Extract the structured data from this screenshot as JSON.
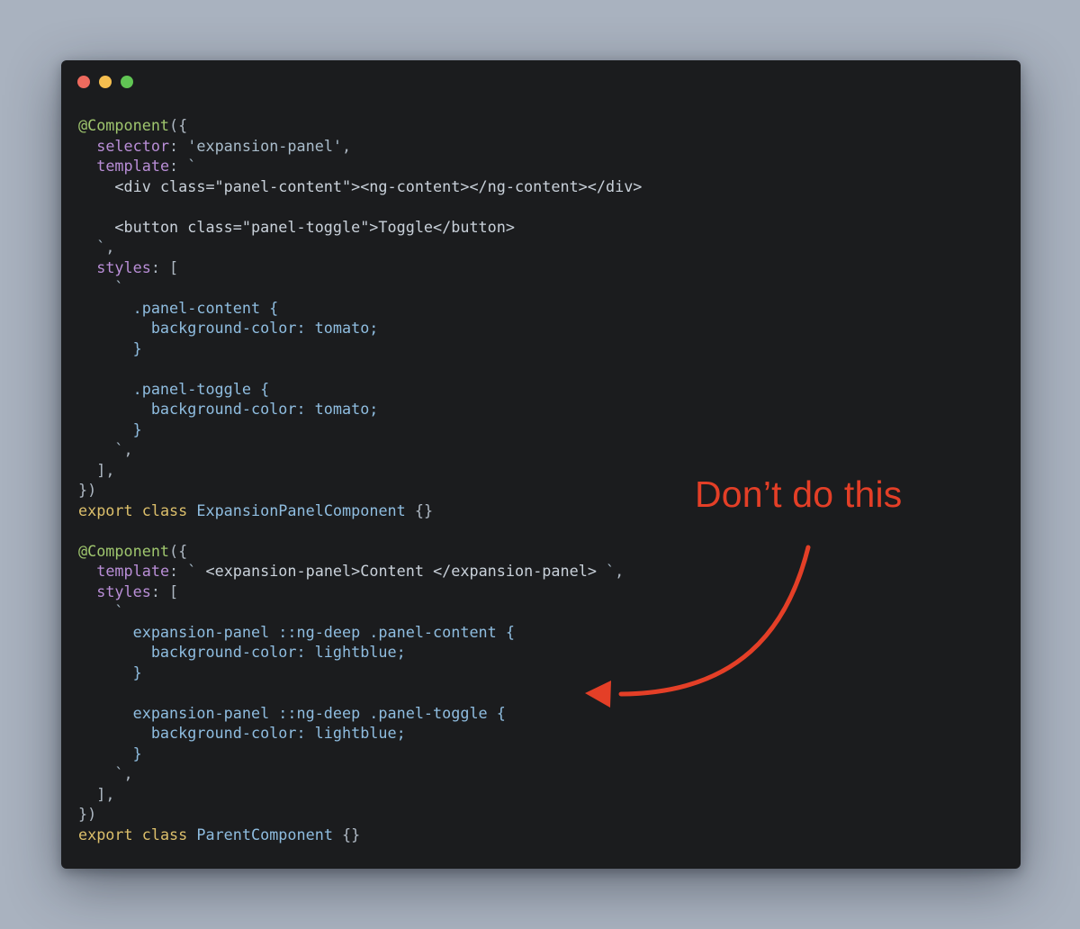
{
  "window": {
    "controls": [
      {
        "name": "close",
        "color": "#ee6a5e"
      },
      {
        "name": "minimize",
        "color": "#f5be4f"
      },
      {
        "name": "zoom",
        "color": "#61c554"
      }
    ]
  },
  "annotation": {
    "text": "Don’t do this",
    "color": "#e43f27"
  },
  "code_lines": [
    [
      {
        "t": "@Component",
        "c": "dec"
      },
      {
        "t": "({",
        "c": "pun"
      }
    ],
    [
      {
        "t": "  "
      },
      {
        "t": "selector",
        "c": "prop"
      },
      {
        "t": ": ",
        "c": "pun"
      },
      {
        "t": "'expansion-panel'",
        "c": "str"
      },
      {
        "t": ",",
        "c": "pun"
      }
    ],
    [
      {
        "t": "  "
      },
      {
        "t": "template",
        "c": "prop"
      },
      {
        "t": ": ",
        "c": "pun"
      },
      {
        "t": "`",
        "c": "str"
      }
    ],
    [
      {
        "t": "    "
      },
      {
        "t": "<div class=\"panel-content\"><ng-content></ng-content></div>",
        "c": "tag"
      }
    ],
    [
      {
        "t": ""
      }
    ],
    [
      {
        "t": "    "
      },
      {
        "t": "<button class=\"panel-toggle\">Toggle</button>",
        "c": "tag"
      }
    ],
    [
      {
        "t": "  "
      },
      {
        "t": "`",
        "c": "str"
      },
      {
        "t": ",",
        "c": "pun"
      }
    ],
    [
      {
        "t": "  "
      },
      {
        "t": "styles",
        "c": "prop"
      },
      {
        "t": ": [",
        "c": "pun"
      }
    ],
    [
      {
        "t": "    "
      },
      {
        "t": "`",
        "c": "str"
      }
    ],
    [
      {
        "t": "      "
      },
      {
        "t": ".panel-content {",
        "c": "css"
      }
    ],
    [
      {
        "t": "        "
      },
      {
        "t": "background-color: tomato;",
        "c": "css"
      }
    ],
    [
      {
        "t": "      "
      },
      {
        "t": "}",
        "c": "css"
      }
    ],
    [
      {
        "t": ""
      }
    ],
    [
      {
        "t": "      "
      },
      {
        "t": ".panel-toggle {",
        "c": "css"
      }
    ],
    [
      {
        "t": "        "
      },
      {
        "t": "background-color: tomato;",
        "c": "css"
      }
    ],
    [
      {
        "t": "      "
      },
      {
        "t": "}",
        "c": "css"
      }
    ],
    [
      {
        "t": "    "
      },
      {
        "t": "`",
        "c": "str"
      },
      {
        "t": ",",
        "c": "pun"
      }
    ],
    [
      {
        "t": "  "
      },
      {
        "t": "],",
        "c": "pun"
      }
    ],
    [
      {
        "t": "})",
        "c": "pun"
      }
    ],
    [
      {
        "t": "export",
        "c": "kw"
      },
      {
        "t": " "
      },
      {
        "t": "class",
        "c": "kw"
      },
      {
        "t": " "
      },
      {
        "t": "ExpansionPanelComponent",
        "c": "cls"
      },
      {
        "t": " {}",
        "c": "pun"
      }
    ],
    [
      {
        "t": ""
      }
    ],
    [
      {
        "t": "@Component",
        "c": "dec"
      },
      {
        "t": "({",
        "c": "pun"
      }
    ],
    [
      {
        "t": "  "
      },
      {
        "t": "template",
        "c": "prop"
      },
      {
        "t": ": ",
        "c": "pun"
      },
      {
        "t": "` ",
        "c": "str"
      },
      {
        "t": "<expansion-panel>Content </expansion-panel>",
        "c": "tag"
      },
      {
        "t": " `",
        "c": "str"
      },
      {
        "t": ",",
        "c": "pun"
      }
    ],
    [
      {
        "t": "  "
      },
      {
        "t": "styles",
        "c": "prop"
      },
      {
        "t": ": [",
        "c": "pun"
      }
    ],
    [
      {
        "t": "    "
      },
      {
        "t": "`",
        "c": "str"
      }
    ],
    [
      {
        "t": "      "
      },
      {
        "t": "expansion-panel ::ng-deep .panel-content {",
        "c": "css"
      }
    ],
    [
      {
        "t": "        "
      },
      {
        "t": "background-color: lightblue;",
        "c": "css"
      }
    ],
    [
      {
        "t": "      "
      },
      {
        "t": "}",
        "c": "css"
      }
    ],
    [
      {
        "t": ""
      }
    ],
    [
      {
        "t": "      "
      },
      {
        "t": "expansion-panel ::ng-deep .panel-toggle {",
        "c": "css"
      }
    ],
    [
      {
        "t": "        "
      },
      {
        "t": "background-color: lightblue;",
        "c": "css"
      }
    ],
    [
      {
        "t": "      "
      },
      {
        "t": "}",
        "c": "css"
      }
    ],
    [
      {
        "t": "    "
      },
      {
        "t": "`",
        "c": "str"
      },
      {
        "t": ",",
        "c": "pun"
      }
    ],
    [
      {
        "t": "  "
      },
      {
        "t": "],",
        "c": "pun"
      }
    ],
    [
      {
        "t": "})",
        "c": "pun"
      }
    ],
    [
      {
        "t": "export",
        "c": "kw"
      },
      {
        "t": " "
      },
      {
        "t": "class",
        "c": "kw"
      },
      {
        "t": " "
      },
      {
        "t": "ParentComponent",
        "c": "cls"
      },
      {
        "t": " {}",
        "c": "pun"
      }
    ]
  ]
}
